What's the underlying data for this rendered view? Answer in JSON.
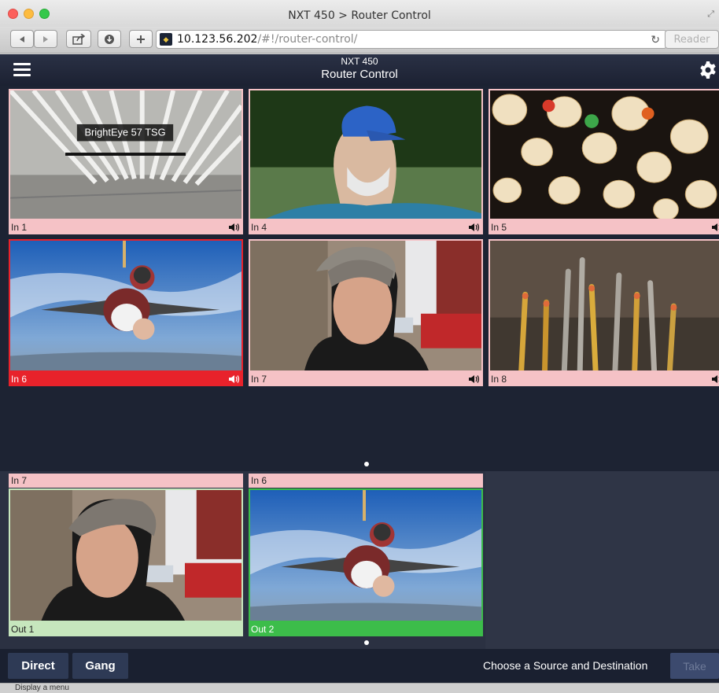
{
  "window": {
    "title": "NXT 450 > Router Control"
  },
  "browser": {
    "url_host": "10.123.56.202",
    "url_path": "/#!/router-control/",
    "reader_label": "Reader"
  },
  "app": {
    "device": "NXT 450",
    "page": "Router Control"
  },
  "sources": [
    {
      "label": "In 1",
      "overlay_text": "BrightEye 57 TSG",
      "selected": false
    },
    {
      "label": "In 4",
      "selected": false
    },
    {
      "label": "In 5",
      "selected": false
    },
    {
      "label": "In 6",
      "selected": true
    },
    {
      "label": "In 7",
      "selected": false
    },
    {
      "label": "In 8",
      "selected": false
    }
  ],
  "destinations": [
    {
      "source_label": "In 7",
      "label": "Out 1",
      "selected": false
    },
    {
      "source_label": "In 6",
      "label": "Out 2",
      "selected": true
    }
  ],
  "bottom": {
    "direct_label": "Direct",
    "gang_label": "Gang",
    "status": "Choose a Source and Destination",
    "take_label": "Take"
  },
  "statusbar": {
    "text": "Display a menu"
  },
  "colors": {
    "source_label_bg": "#f5c2c6",
    "source_selected_bg": "#e8222b",
    "dest_label_bg": "#c6e6bd",
    "dest_selected_bg": "#3cbd4a",
    "app_bg": "#1f2535"
  }
}
